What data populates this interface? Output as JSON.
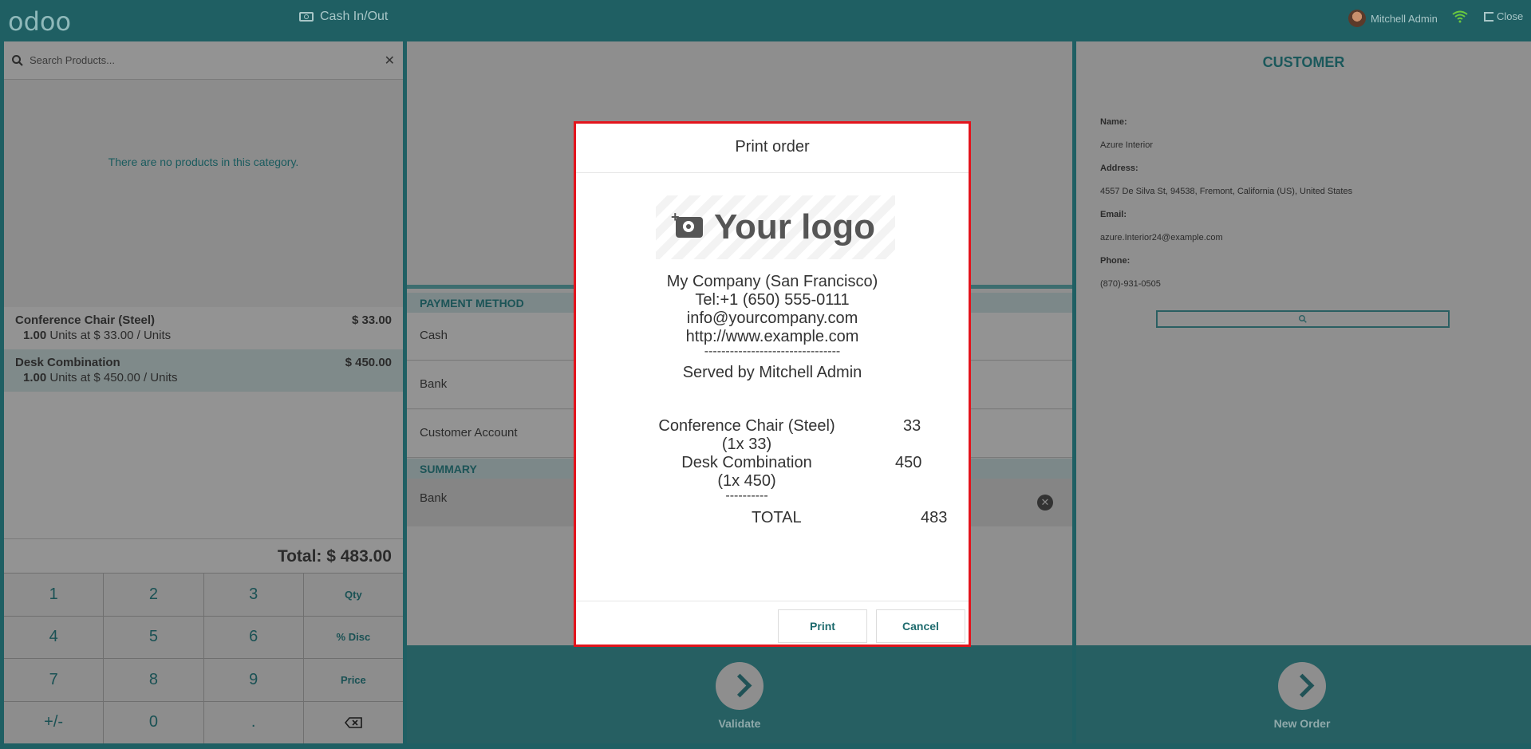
{
  "topbar": {
    "logo": "odoo",
    "cash_label": "Cash In/Out",
    "user_name": "Mitchell Admin",
    "close_label": "Close"
  },
  "left": {
    "search_placeholder": "Search Products...",
    "empty_message": "There are no products in this category.",
    "orderlines": [
      {
        "name": "Conference Chair (Steel)",
        "price": "$ 33.00",
        "qty": "1.00",
        "unit_text": "Units at $ 33.00 / Units"
      },
      {
        "name": "Desk Combination",
        "price": "$ 450.00",
        "qty": "1.00",
        "unit_text": "Units at $ 450.00 / Units"
      }
    ],
    "total": "Total: $ 483.00",
    "numpad": [
      "1",
      "2",
      "3",
      "Qty",
      "4",
      "5",
      "6",
      "% Disc",
      "7",
      "8",
      "9",
      "Price",
      "+/-",
      "0",
      "."
    ]
  },
  "payment": {
    "method_header": "PAYMENT METHOD",
    "methods": [
      "Cash",
      "Bank",
      "Customer Account"
    ],
    "summary_header": "SUMMARY",
    "summary_line": "Bank",
    "validate_label": "Validate"
  },
  "customer": {
    "title": "CUSTOMER",
    "name_label": "Name:",
    "name": "Azure Interior",
    "address_label": "Address:",
    "address": "4557 De Silva St, 94538, Fremont, California (US), United States",
    "email_label": "Email:",
    "email": "azure.Interior24@example.com",
    "phone_label": "Phone:",
    "phone": "(870)-931-0505",
    "new_order_label": "New Order"
  },
  "modal": {
    "title": "Print order",
    "logo_text": "Your logo",
    "company": "My Company (San Francisco)",
    "tel": "Tel:+1 (650) 555-0111",
    "email": "info@yourcompany.com",
    "website": "http://www.example.com",
    "separator": "--------------------------------",
    "served_by": "Served by Mitchell Admin",
    "items": [
      {
        "name": "Conference Chair (Steel)",
        "amount": "33",
        "detail": "(1x 33)"
      },
      {
        "name": "Desk Combination",
        "amount": "450",
        "detail": "(1x 450)"
      }
    ],
    "short_separator": "----------",
    "total_label": "TOTAL",
    "total_value": "483",
    "print_label": "Print",
    "cancel_label": "Cancel"
  },
  "colors": {
    "brand_teal": "#1f5f63",
    "modal_border": "#e3141c"
  }
}
